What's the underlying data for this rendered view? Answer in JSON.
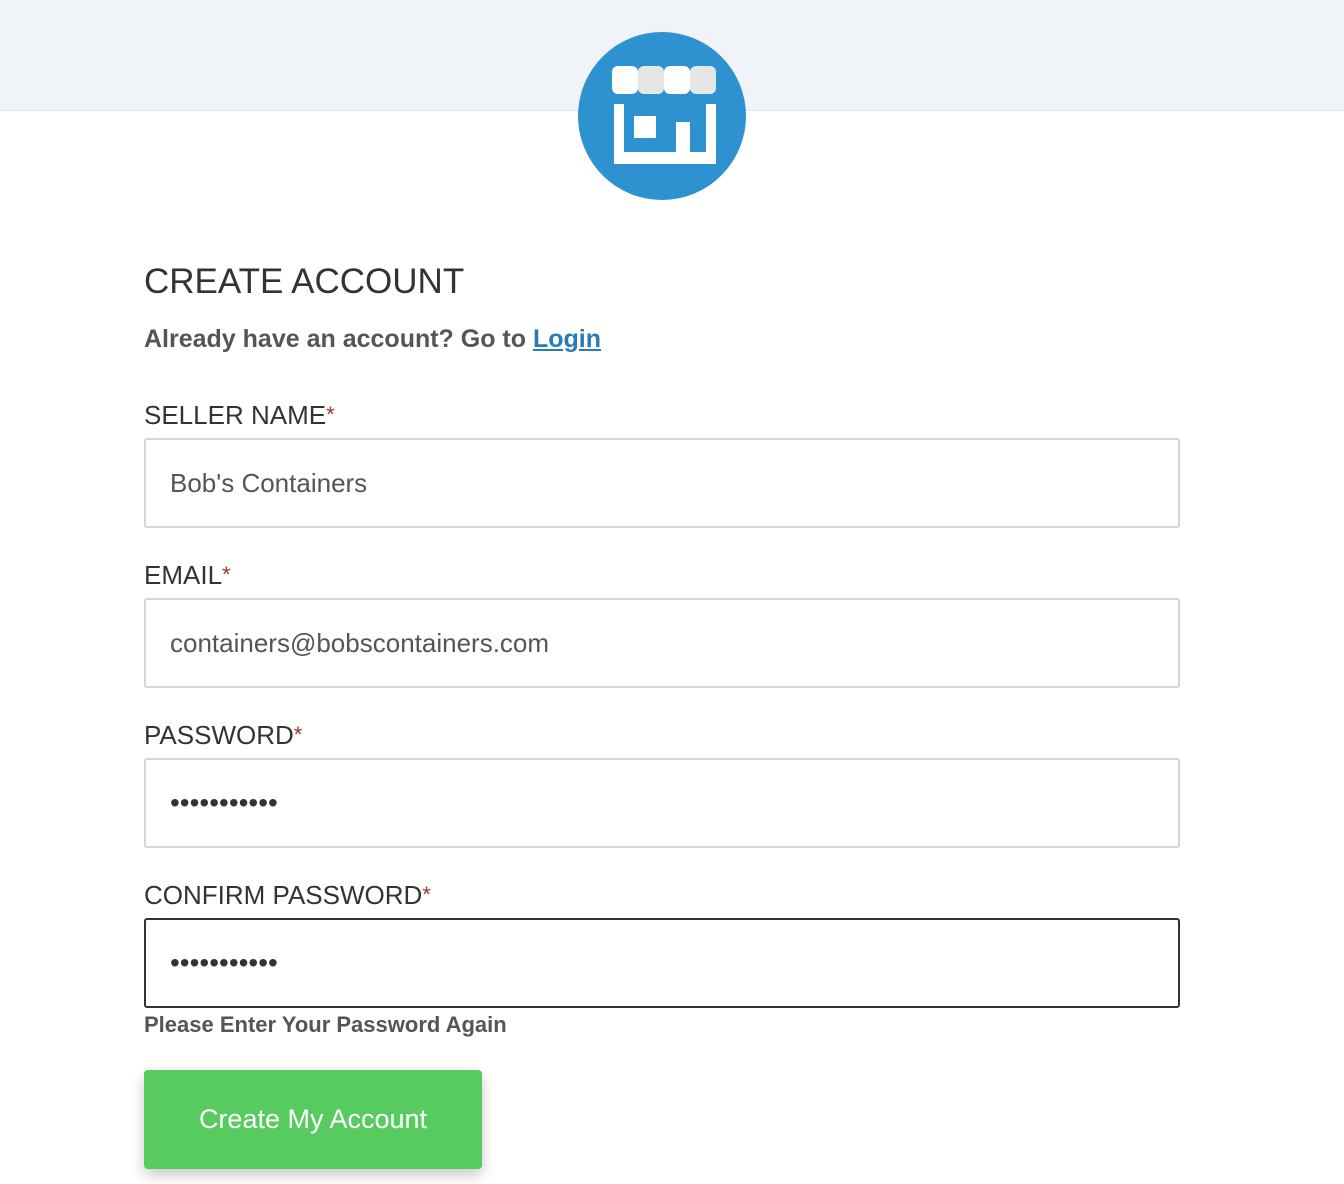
{
  "brand": {
    "logo_icon": "storefront-icon",
    "logo_color": "#2f92d0"
  },
  "page": {
    "title": "CREATE ACCOUNT",
    "login_prompt": "Already have an account? Go to",
    "login_link": "Login"
  },
  "form": {
    "required_marker": "*",
    "seller_name": {
      "label": "SELLER NAME",
      "value": "Bob's Containers"
    },
    "email": {
      "label": "EMAIL",
      "value": "containers@bobscontainers.com"
    },
    "password": {
      "label": "PASSWORD",
      "masked_value": "•••••••••••"
    },
    "confirm_password": {
      "label": "CONFIRM PASSWORD",
      "masked_value": "•••••••••••",
      "help_text": "Please Enter Your Password Again"
    },
    "submit_label": "Create My Account"
  },
  "colors": {
    "submit_button": "#58cb60",
    "link": "#2a7ab8",
    "required": "#a03030"
  }
}
